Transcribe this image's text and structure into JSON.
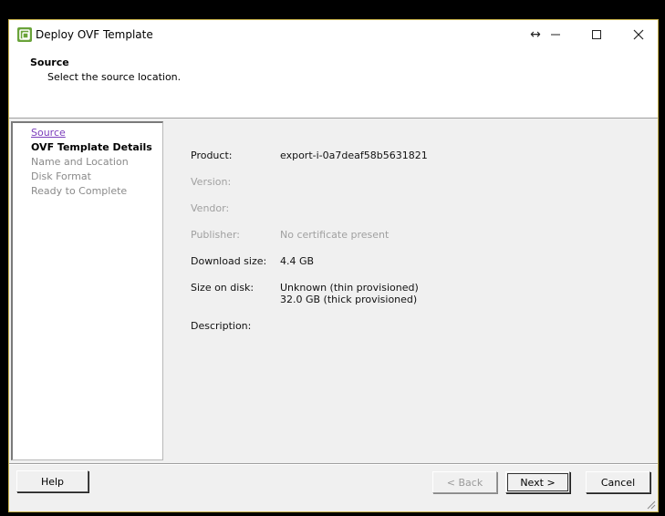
{
  "window": {
    "title": "Deploy OVF Template",
    "title_buttons": [
      "↔",
      "—",
      "☐",
      "✕"
    ]
  },
  "header": {
    "title": "Source",
    "subtitle": "Select the source location."
  },
  "nav": {
    "items": [
      {
        "label": "Source",
        "state": "link"
      },
      {
        "label": "OVF Template Details",
        "state": "current"
      },
      {
        "label": "Name and Location",
        "state": "disabled"
      },
      {
        "label": "Disk Format",
        "state": "disabled"
      },
      {
        "label": "Ready to Complete",
        "state": "disabled"
      }
    ]
  },
  "details": {
    "product_label": "Product:",
    "product_value": "export-i-0a7deaf58b5631821",
    "version_label": "Version:",
    "vendor_label": "Vendor:",
    "publisher_label": "Publisher:",
    "publisher_value": "No certificate present",
    "download_label": "Download size:",
    "download_value": "4.4 GB",
    "disk_label": "Size on disk:",
    "disk_value_1": "Unknown (thin provisioned)",
    "disk_value_2": "32.0 GB (thick provisioned)",
    "description_label": "Description:"
  },
  "buttons": {
    "help": "Help",
    "back": "< Back",
    "next": "Next >",
    "cancel": "Cancel"
  },
  "colors": {
    "accent_border": "#c9b24b",
    "link": "#7b3dbb"
  }
}
